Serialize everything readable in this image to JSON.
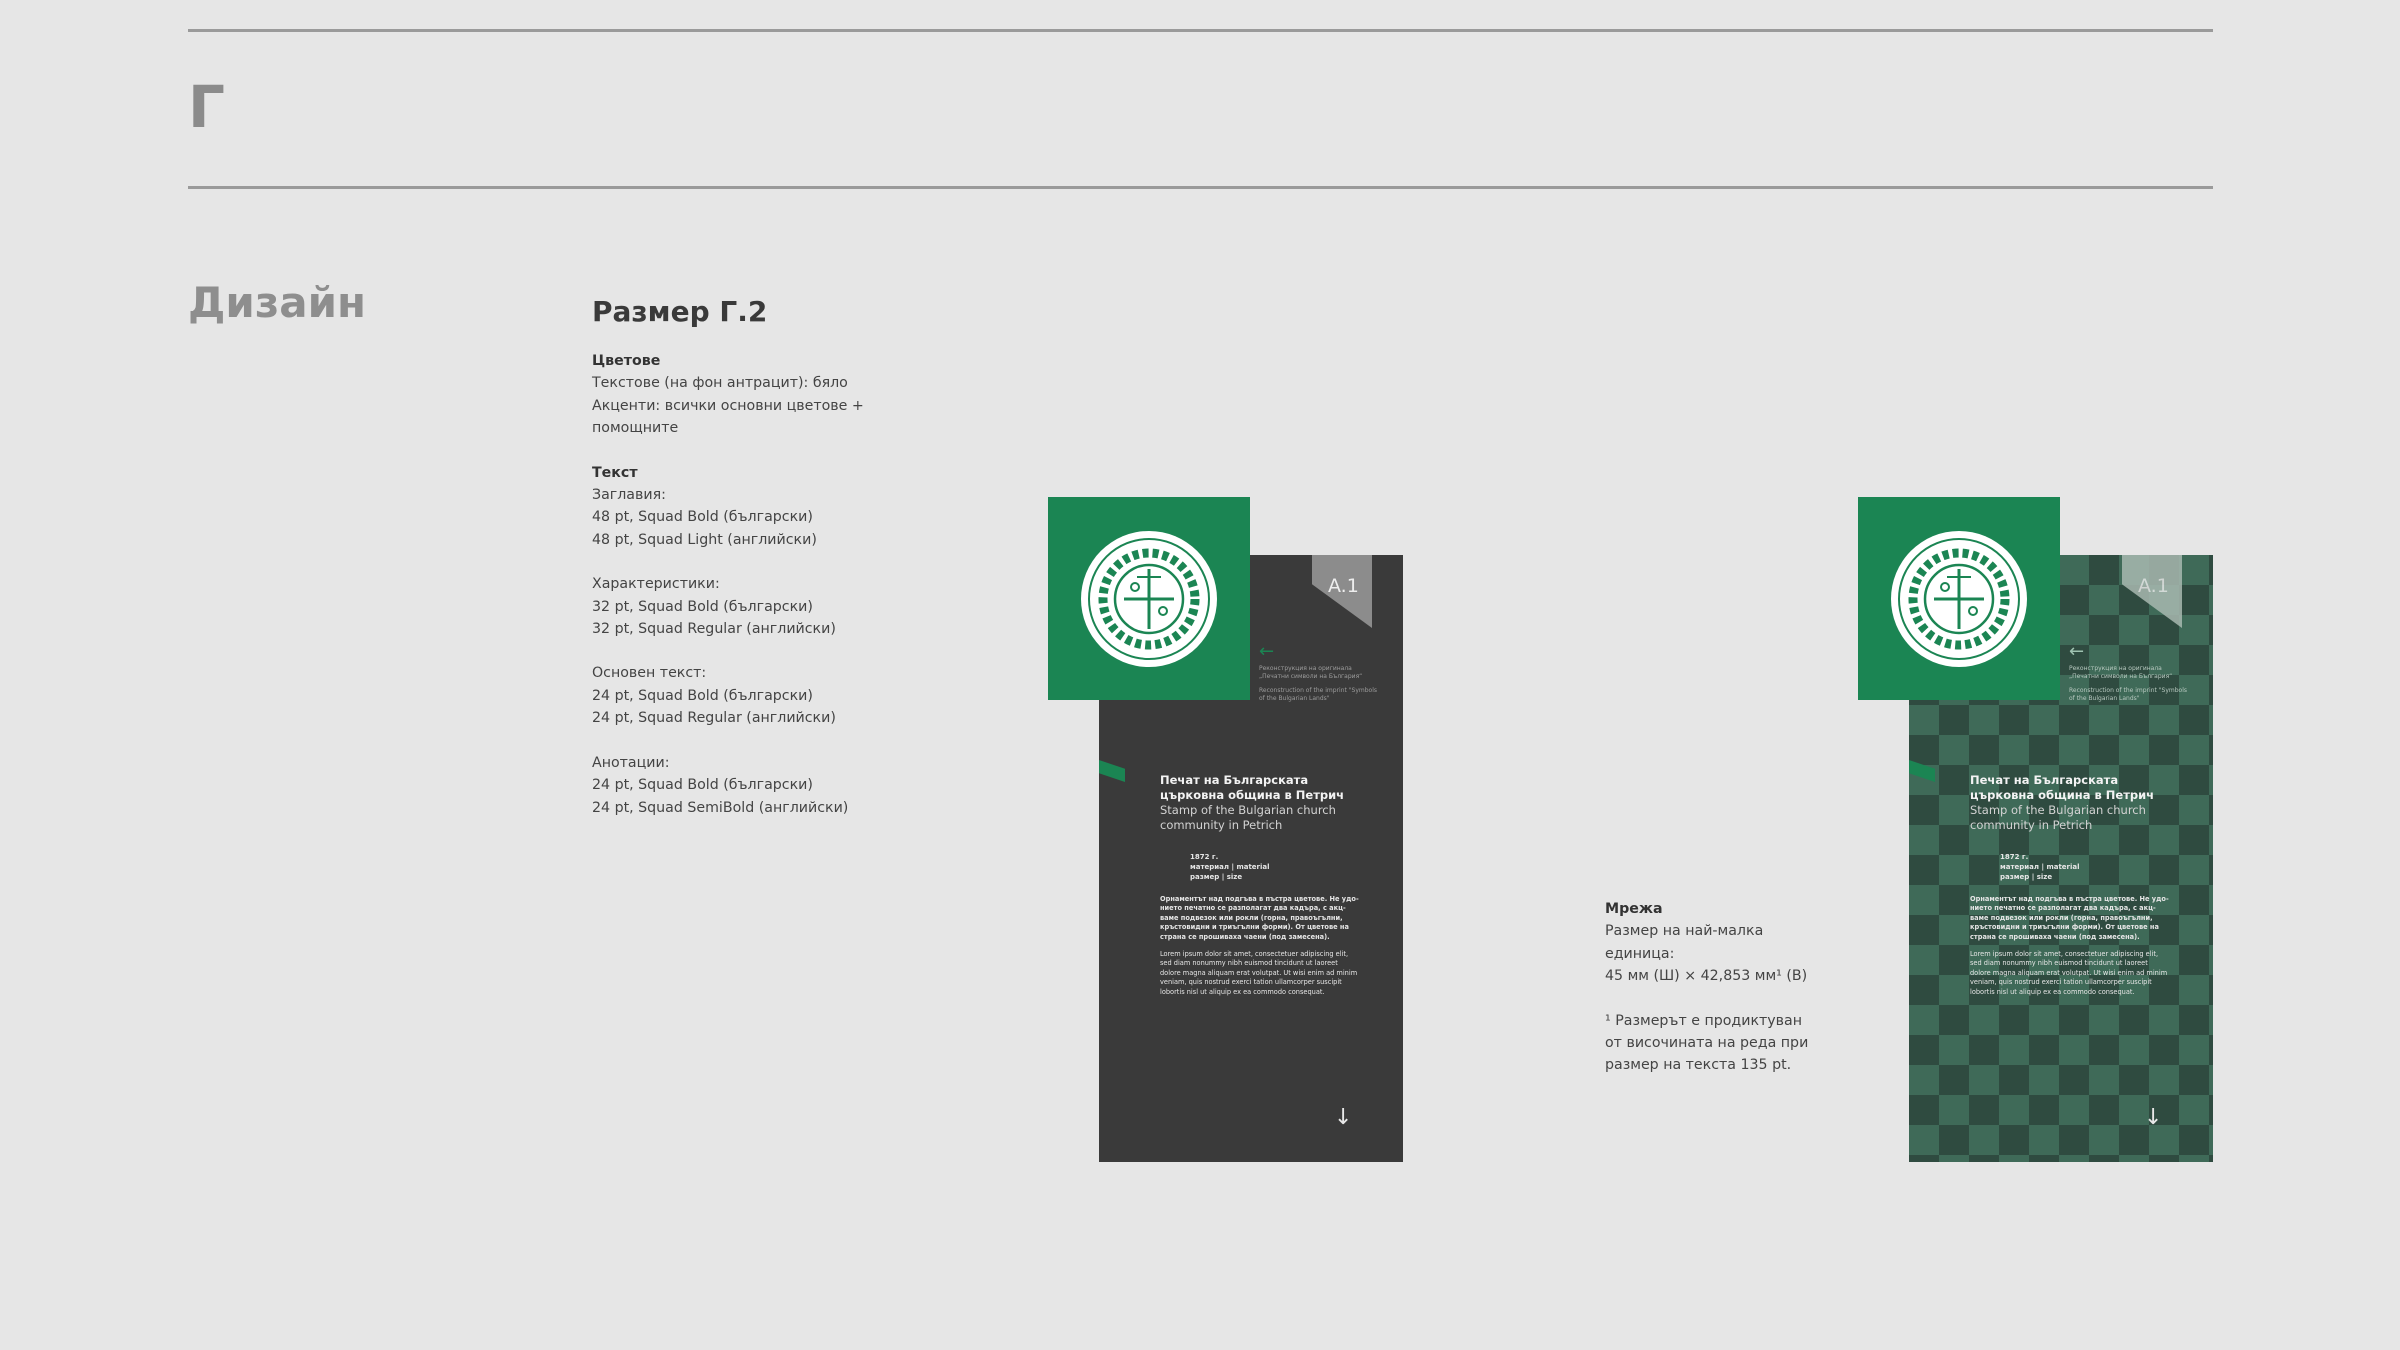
{
  "header": {
    "letter": "Г"
  },
  "section": {
    "title": "Дизайн"
  },
  "spec": {
    "title": "Размер Г.2",
    "colors": {
      "heading": "Цветове",
      "texts": "Текстове (на фон антрацит): бяло",
      "accents": "Акценти: всички основни цветове + помощните"
    },
    "text": {
      "heading": "Текст",
      "titles_label": "Заглавия:",
      "titles_bg": "48 pt, Squad Bold (български)",
      "titles_en": "48 pt, Squad Light (английски)",
      "chars_label": "Характеристики:",
      "chars_bg": "32 pt, Squad Bold (български)",
      "chars_en": "32 pt, Squad Regular (английски)",
      "main_label": "Основен текст:",
      "main_bg": "24 pt, Squad Bold (български)",
      "main_en": "24 pt, Squad Regular (английски)",
      "notes_label": "Анотации:",
      "notes_bg": "24 pt, Squad Bold (български)",
      "notes_en": "24 pt, Squad SemiBold (английски)"
    }
  },
  "grid": {
    "heading": "Мрежа",
    "unit_label_1": "Размер на най-малка",
    "unit_label_2": "единица:",
    "unit_value": "45 мм (Ш) × 42,853 мм¹ (В)",
    "footnote_1": "¹ Размерът е продиктуван",
    "footnote_2": "от височината на реда при",
    "footnote_3": "размер на текста 135 pt."
  },
  "mockup": {
    "tag": "A.1",
    "reconstruction_bg": "Реконструкция на оригинала „Печатни символи на България“",
    "reconstruction_en": "Reconstruction of the imprint \"Symbols of the Bulgarian Lands\"",
    "title_bg_1": "Печат на Българската",
    "title_bg_2": "църковна община в Петрич",
    "title_en_1": "Stamp of the Bulgarian church",
    "title_en_2": "community in Petrich",
    "meta_year": "1872 г.",
    "meta_material": "материал | material",
    "meta_size": "размер | size",
    "body_bg": "Орнаментът над подгъва в пъстра цветове. Не удо-нието печатно се разполагат два кадъра, с акц-ваме подвезок или рокли (горна, правоъгълни, кръстовидни и триъгълни форми). От цветове на страна се прошиваха чаени (под замесена).",
    "body_lorem": "Lorem ipsum dolor sit amet, consectetuer adipiscing elit, sed diam nonummy nibh euismod tincidunt ut laoreet dolore magna aliquam erat volutpat. Ut wisi enim ad minim veniam, quis nostrud exerci tation ullamcorper suscipit lobortis nisl ut aliquip ex ea commodo consequat."
  },
  "colors": {
    "background": "#e6e6e6",
    "green": "#1b8553",
    "anthracite": "#3a3a3a",
    "checker_dark": "#2f4b40",
    "checker_light": "#3f6a58"
  }
}
